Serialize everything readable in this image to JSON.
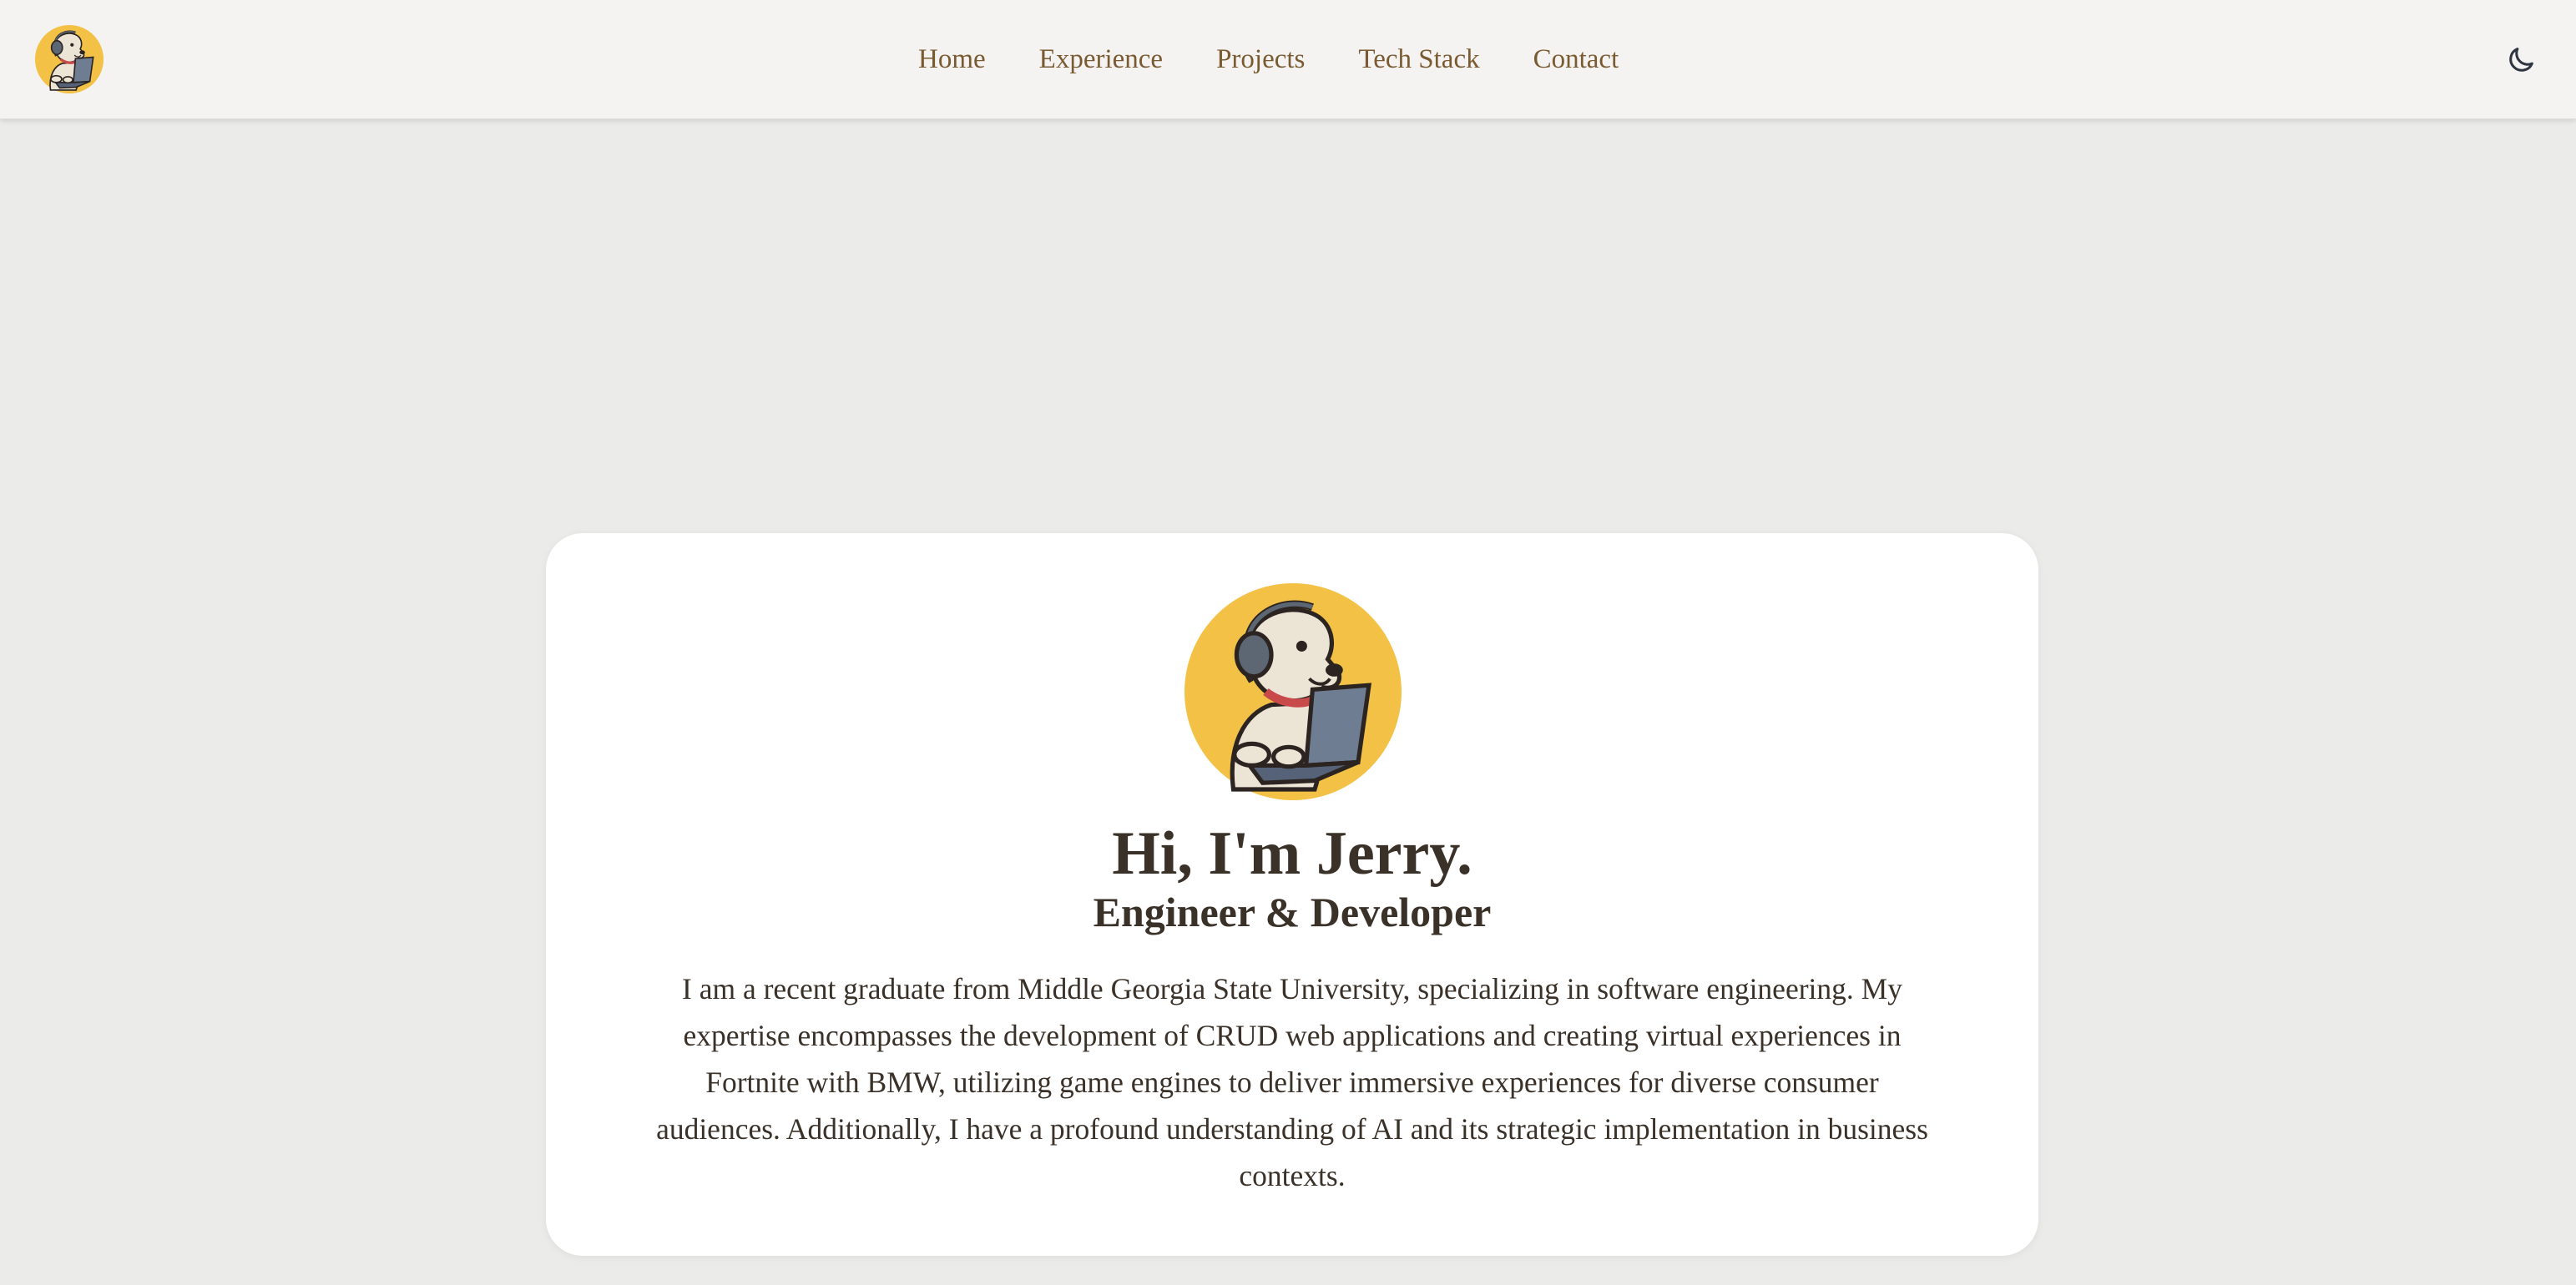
{
  "colors": {
    "page_background": "#ebebea",
    "navbar_background": "#f4f3f2",
    "nav_link": "#7a5a30",
    "text": "#3a3129",
    "card_background": "#ffffff",
    "avatar_background": "#f2c146"
  },
  "navbar": {
    "logo_icon": "dog-with-laptop-logo",
    "links": [
      {
        "label": "Home"
      },
      {
        "label": "Experience"
      },
      {
        "label": "Projects"
      },
      {
        "label": "Tech Stack"
      },
      {
        "label": "Contact"
      }
    ],
    "theme_toggle_icon": "moon-icon"
  },
  "hero": {
    "avatar_icon": "dog-with-laptop-avatar",
    "title": "Hi, I'm Jerry.",
    "subtitle": "Engineer & Developer",
    "bio": "I am a recent graduate from Middle Georgia State University, specializing in software engineering. My expertise encompasses the development of CRUD web applications and creating virtual experiences in Fortnite with BMW, utilizing game engines to deliver immersive experiences for diverse consumer audiences. Additionally, I have a profound understanding of AI and its strategic implementation in business contexts."
  }
}
